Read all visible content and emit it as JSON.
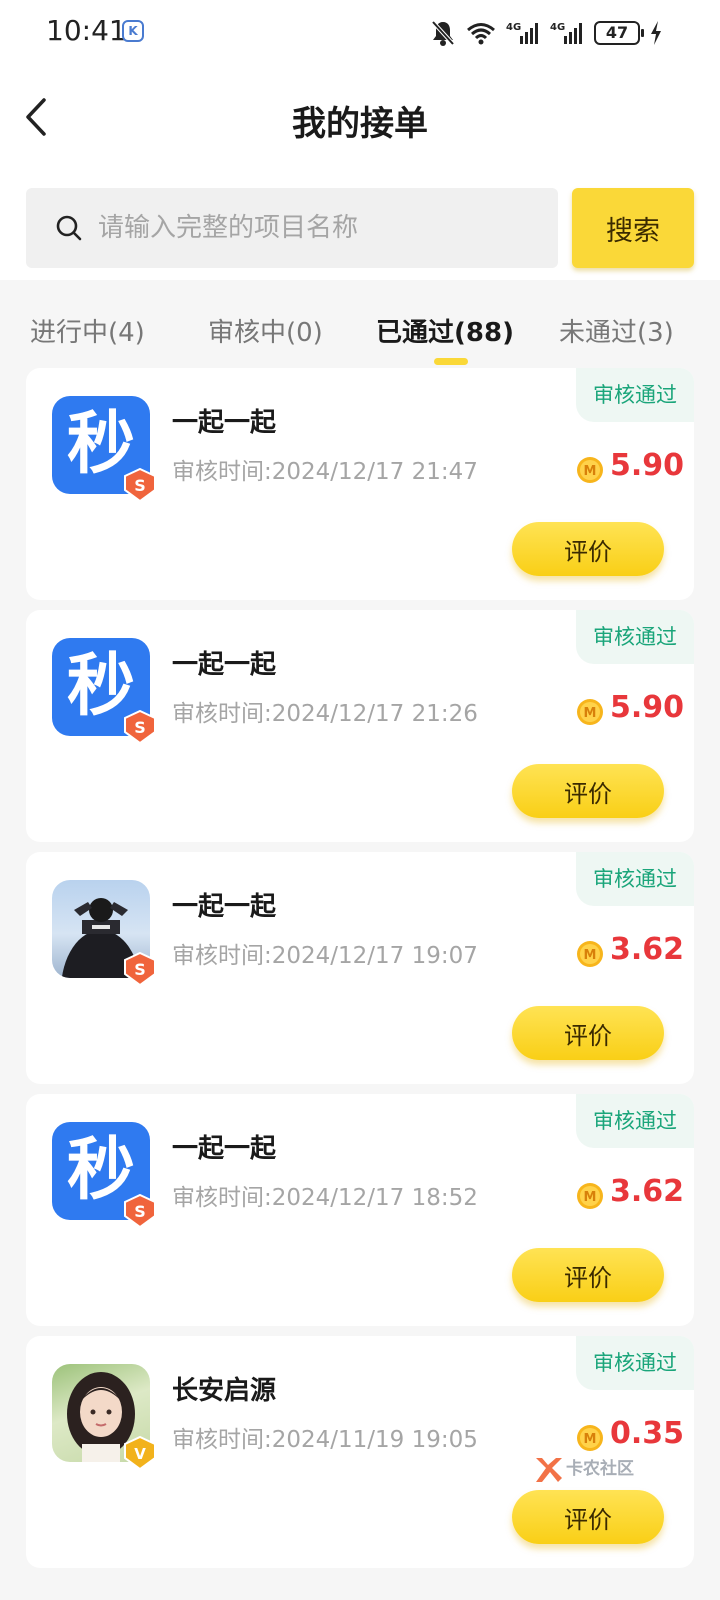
{
  "status_bar": {
    "time": "10:41",
    "battery": "47",
    "network": "4G"
  },
  "header": {
    "title": "我的接单"
  },
  "search": {
    "placeholder": "请输入完整的项目名称",
    "button_label": "搜索"
  },
  "tabs": [
    {
      "label": "进行中(4)",
      "active": false
    },
    {
      "label": "审核中(0)",
      "active": false
    },
    {
      "label": "已通过(88)",
      "active": true
    },
    {
      "label": "未通过(3)",
      "active": false
    }
  ],
  "orders": [
    {
      "avatar": "秒",
      "title": "一起一起",
      "time": "审核时间:2024/12/17 21:47",
      "status": "审核通过",
      "reward": "5.90",
      "badge": "S",
      "action": "评价"
    },
    {
      "avatar": "秒",
      "title": "一起一起",
      "time": "审核时间:2024/12/17 21:26",
      "status": "审核通过",
      "reward": "5.90",
      "badge": "S",
      "action": "评价"
    },
    {
      "avatar": "",
      "title": "一起一起",
      "time": "审核时间:2024/12/17 19:07",
      "status": "审核通过",
      "reward": "3.62",
      "badge": "S",
      "action": "评价"
    },
    {
      "avatar": "秒",
      "title": "一起一起",
      "time": "审核时间:2024/12/17 18:52",
      "status": "审核通过",
      "reward": "3.62",
      "badge": "S",
      "action": "评价"
    },
    {
      "avatar": "",
      "title": "长安启源",
      "time": "审核时间:2024/11/19 19:05",
      "status": "审核通过",
      "reward": "0.35",
      "badge": "V",
      "action": "评价"
    }
  ],
  "coin_symbol": "M",
  "watermark": "卡农社区",
  "colors": {
    "accent": "#fad838",
    "reward": "#e8373b",
    "status": "#1aa57a",
    "app_blue": "#2f7af0"
  }
}
